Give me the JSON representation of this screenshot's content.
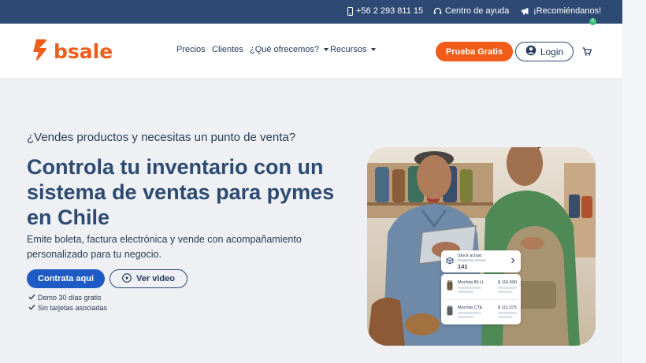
{
  "topbar": {
    "phone": "+56 2 293 811 15",
    "help": "Centro de ayuda",
    "recommend": "¡Recomiéndanos!"
  },
  "header": {
    "logo_text": "bsale",
    "nav": [
      {
        "label": "Precios"
      },
      {
        "label": "Clientes"
      },
      {
        "label": "¿Qué ofrecemos?"
      },
      {
        "label": "Recursos"
      }
    ],
    "trial_label": "Prueba Gratis",
    "login_label": "Login",
    "cart_count": "0"
  },
  "hero": {
    "kicker": "¿Vendes productos y necesitas un punto de venta?",
    "headline": "Controla tu inventario con un sistema de ventas para pymes en Chile",
    "subtext": "Emite boleta, factura electrónica y vende con acompañamiento personalizado para tu negocio.",
    "cta_primary": "Contrata aquí",
    "cta_video": "Ver video",
    "checks": [
      "Demo 30 días gratis",
      "Sin tarjetas asociadas"
    ]
  },
  "stock_card": {
    "title": "Stock actual",
    "subtitle": "Productos activos",
    "value": "141"
  },
  "products": [
    {
      "name": "Mochila 80 Lt",
      "price": "$ 116.590"
    },
    {
      "name": "Mochila CTE",
      "price": "$ 111.075"
    }
  ],
  "colors": {
    "brand_orange": "#f25c19",
    "navy": "#2e4a74",
    "primary_blue": "#1f5bc4",
    "badge_green": "#33c47a"
  }
}
